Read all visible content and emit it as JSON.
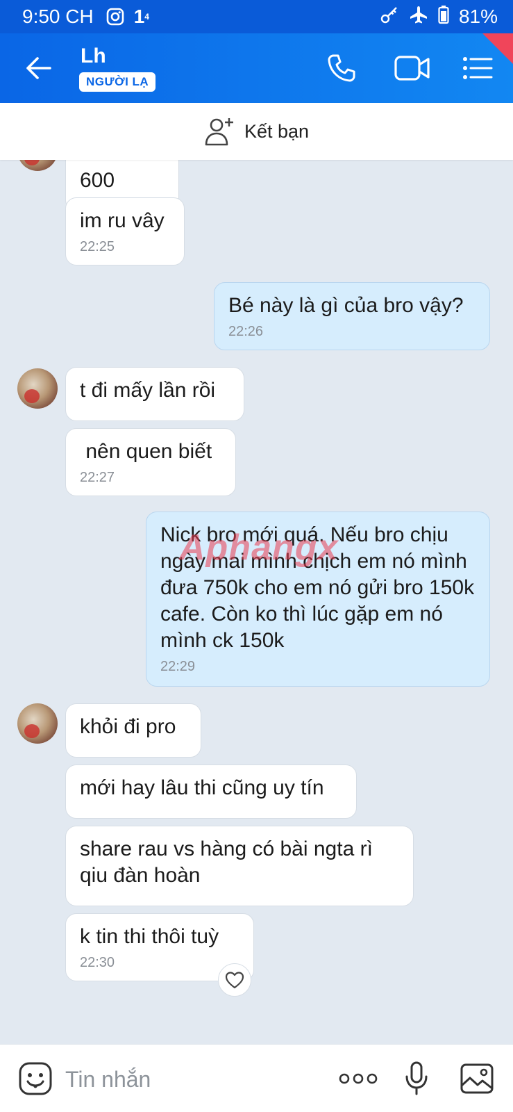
{
  "status_bar": {
    "time": "9:50 CH",
    "signal_text": "1",
    "signal_sup": "4",
    "battery": "81%"
  },
  "header": {
    "name": "Lh",
    "badge": "NGƯỜI LẠ"
  },
  "add_friend": {
    "label": "Kết bạn"
  },
  "messages": [
    {
      "side": "them",
      "text": "600",
      "time": ""
    },
    {
      "side": "them",
      "text": "im ru vây",
      "time": "22:25"
    },
    {
      "side": "me",
      "text": "Bé này là gì của bro vậy?",
      "time": "22:26"
    },
    {
      "side": "them",
      "text": "t đi mấy lần rồi",
      "time": ""
    },
    {
      "side": "them",
      "text": " nên quen biết",
      "time": "22:27"
    },
    {
      "side": "me",
      "text": "Nick bro mới quá. Nếu bro chịu ngày mai mình chịch em nó mình đưa 750k cho em nó gửi bro 150k cafe. Còn ko thì lúc gặp em nó mình ck 150k",
      "time": "22:29"
    },
    {
      "side": "them",
      "text": "khỏi đi pro",
      "time": ""
    },
    {
      "side": "them",
      "text": "mới hay lâu thi cũng uy tín",
      "time": ""
    },
    {
      "side": "them",
      "text": "share rau vs hàng có bài ngta rì qiu đàn hoàn",
      "time": ""
    },
    {
      "side": "them",
      "text": "k tin thi thôi tuỳ",
      "time": "22:30"
    }
  ],
  "watermark": "Aphangx",
  "input": {
    "placeholder": "Tin nhắn"
  },
  "icons": {
    "back": "arrow-left-icon",
    "call": "phone-icon",
    "video": "video-camera-icon",
    "menu": "list-menu-icon",
    "add_friend": "add-user-icon",
    "emoji": "sticker-icon",
    "more": "more-dots-icon",
    "mic": "microphone-icon",
    "gallery": "image-icon",
    "reaction": "heart-icon"
  },
  "colors": {
    "header": "#0a66e6",
    "my_bubble": "#d6edfd",
    "background": "#e2e9f1"
  }
}
